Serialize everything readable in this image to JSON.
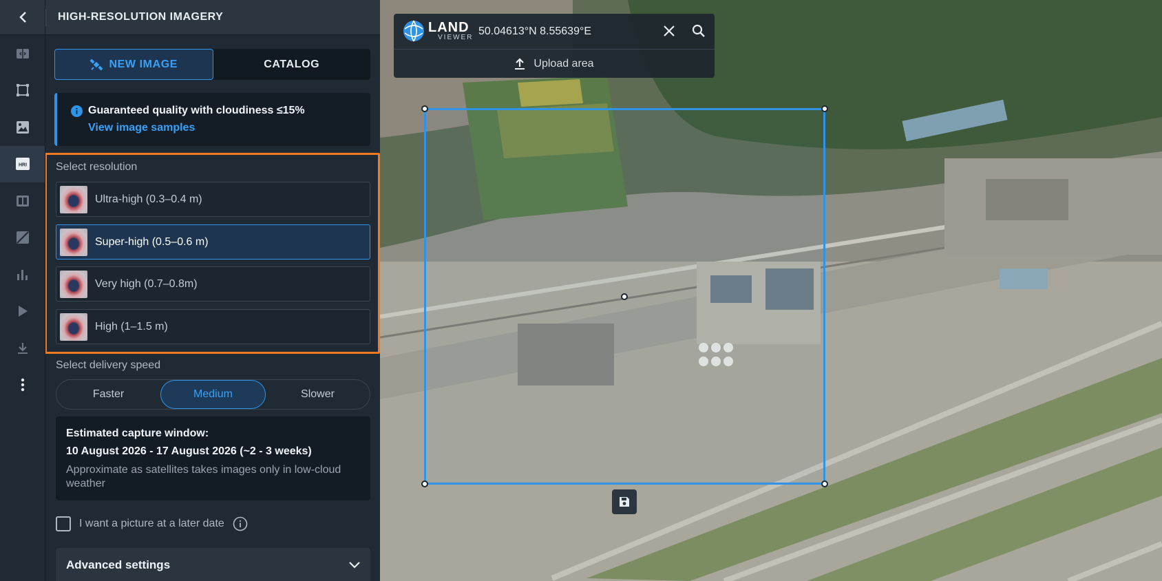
{
  "panel": {
    "title": "HIGH-RESOLUTION IMAGERY",
    "tabs": [
      {
        "label": "NEW IMAGE",
        "active": true
      },
      {
        "label": "CATALOG",
        "active": false
      }
    ],
    "info": {
      "text": "Guaranteed quality with cloudiness ≤15%",
      "link": "View image samples"
    },
    "resolution": {
      "label": "Select resolution",
      "options": [
        {
          "label": "Ultra-high (0.3–0.4 m)",
          "selected": false
        },
        {
          "label": "Super-high (0.5–0.6 m)",
          "selected": true
        },
        {
          "label": "Very high (0.7–0.8m)",
          "selected": false
        },
        {
          "label": "High (1–1.5 m)",
          "selected": false
        }
      ]
    },
    "delivery": {
      "label": "Select delivery speed",
      "options": [
        "Faster",
        "Medium",
        "Slower"
      ],
      "selected": "Medium"
    },
    "estimate": {
      "title": "Estimated capture window:",
      "dates": "10 August 2026 - 17 August 2026 (~2 - 3 weeks)",
      "note": "Approximate as satellites takes images only in low-cloud weather"
    },
    "later_date": {
      "label": "I want a picture at a later date",
      "checked": false
    },
    "advanced": {
      "label": "Advanced settings"
    }
  },
  "rail": {
    "icons": [
      "back-icon",
      "compare-icon",
      "aoi-icon",
      "imagery-icon",
      "hri-icon",
      "split-icon",
      "no-cloud-icon",
      "analytics-icon",
      "play-icon",
      "download-icon",
      "more-icon"
    ],
    "hri_label": "HRI",
    "active": "hri-icon"
  },
  "map": {
    "logo": {
      "line1": "LAND",
      "line2": "VIEWER"
    },
    "coordinates": "50.04613°N 8.55639°E",
    "upload_label": "Upload area"
  },
  "colors": {
    "accent": "#2f93e8",
    "highlight_border": "#f07a21",
    "panel_bg": "#1f2a35"
  }
}
